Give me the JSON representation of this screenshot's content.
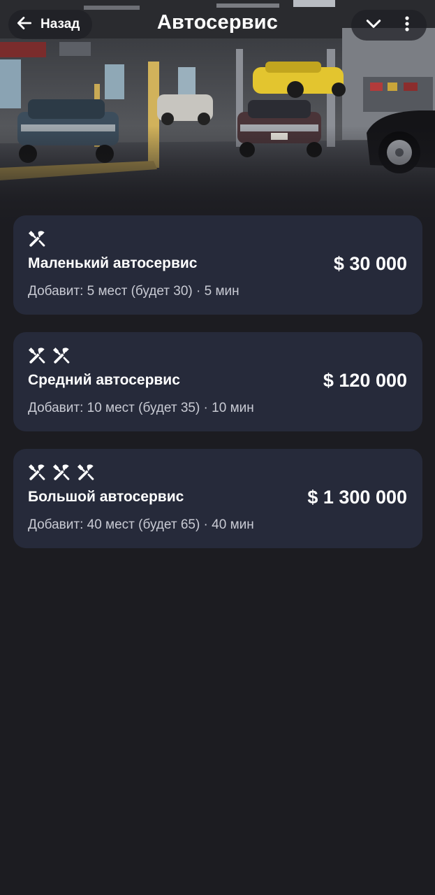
{
  "header": {
    "back_label": "Назад",
    "title": "Автосервис",
    "icons": {
      "back": "arrow-left-icon",
      "collapse": "chevron-down-icon",
      "menu": "more-vertical-icon"
    }
  },
  "hero": {
    "description_icon": "garage-photo"
  },
  "options": [
    {
      "level": 1,
      "icon": "tools-icon",
      "title": "Маленький автосервис",
      "subtitle": "Добавит: 5 мест (будет 30) · 5 мин",
      "price": "$ 30 000"
    },
    {
      "level": 2,
      "icon": "tools-icon",
      "title": "Средний автосервис",
      "subtitle": "Добавит: 10 мест (будет 35) · 10 мин",
      "price": "$ 120 000"
    },
    {
      "level": 3,
      "icon": "tools-icon",
      "title": "Большой автосервис",
      "subtitle": "Добавит: 40 мест (будет 65) · 40 мин",
      "price": "$ 1 300 000"
    }
  ],
  "colors": {
    "background": "#1c1c21",
    "card": "#262a3a",
    "text": "#ffffff",
    "subtext": "#c9cbd4"
  }
}
